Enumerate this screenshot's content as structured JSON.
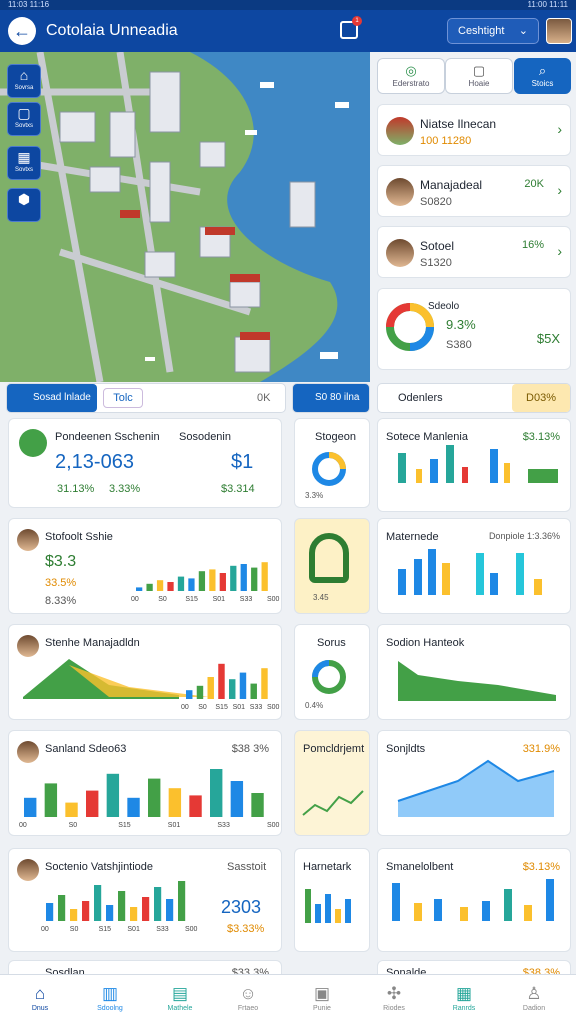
{
  "status": {
    "time": "11:03 11:16",
    "right": "11:00 11:11"
  },
  "header": {
    "title": "Cotolaia Unneadia",
    "location": "Ceshtight",
    "notif_count": "1"
  },
  "map_tools": [
    {
      "icon": "home-icon",
      "label": "Sovrsa"
    },
    {
      "icon": "square-icon",
      "label": "Sovtxs"
    },
    {
      "icon": "grid-icon",
      "label": "Sovtxs"
    },
    {
      "icon": "shield-icon",
      "label": ""
    }
  ],
  "filter_buttons": [
    {
      "label": "Ederstrato",
      "icon": "leaf-icon"
    },
    {
      "label": "Hoaie",
      "icon": "square-icon"
    },
    {
      "label": "Stoics",
      "icon": "search-icon"
    }
  ],
  "users": [
    {
      "name": "Niatse Ilnecan",
      "sub": "100 11280",
      "value": ""
    },
    {
      "name": "Manajadeal",
      "sub": "S0820",
      "value": "20K"
    },
    {
      "name": "Sotoel",
      "sub": "S1320",
      "value": "16%"
    }
  ],
  "summary": {
    "name": "Sdeolo",
    "pct": "9.3%",
    "sub": "S380",
    "value": "$5X"
  },
  "tab_left": {
    "active": "Sosad lnlade",
    "other": "Tolc",
    "aux": "0K"
  },
  "tab_mid": {
    "label": "S0 80 ilna"
  },
  "tab_right": {
    "title": "Odenlers",
    "badge": "D03%"
  },
  "cards_left": [
    {
      "title": "Pondeenen Sschenin",
      "value": "2,13-063",
      "metric": "$1",
      "sub": [
        "31.13%",
        "3.33%",
        "$3.314"
      ],
      "extra": "Sosodenin"
    },
    {
      "title": "Stofoolt Sshie",
      "value": "$3.3",
      "metric": "33.5%",
      "sub": [
        "8.33%"
      ]
    },
    {
      "title": "Stenhe Manajadldn",
      "value": "",
      "metric": "",
      "sub": []
    },
    {
      "title": "Sanland Sdeo63",
      "value": "$38 3%",
      "metric": "",
      "sub": []
    },
    {
      "title": "Soctenio Vatshjintiode",
      "value": "2303",
      "metric": "$3.33%",
      "sub": [],
      "extra": "Sasstoit"
    },
    {
      "title": "Sosdlan",
      "value": "$33 3%",
      "metric": "",
      "sub": []
    }
  ],
  "cards_mid": [
    {
      "title": "Stogeon",
      "value": "3.3%"
    },
    {
      "title": "",
      "value": "3.45"
    },
    {
      "title": "Sorus",
      "value": "0.4%"
    },
    {
      "title": "Pomcldrjemt",
      "value": ""
    },
    {
      "title": "Harnetark",
      "value": ""
    }
  ],
  "cards_right": [
    {
      "title": "Sotece Manlenia",
      "value": "$3.13%"
    },
    {
      "title": "Maternede",
      "value": "Donpiole 1:3.36%"
    },
    {
      "title": "Sodion Hanteok",
      "value": ""
    },
    {
      "title": "Sonjldts",
      "value": "331.9%"
    },
    {
      "title": "Smanelolbent",
      "value": "$3.13%"
    },
    {
      "title": "Sonalde",
      "value": "$38 3%"
    }
  ],
  "axis": [
    "00",
    "S0",
    "S15",
    "S01",
    "S33",
    "S00"
  ],
  "bottom_nav": [
    "Dnus",
    "Sdoolng",
    "Mathele",
    "Frtaeo",
    "Punie",
    "Riodes",
    "Ranrds",
    "Dadion"
  ],
  "chart_data": [
    {
      "type": "bar",
      "series": [
        {
          "name": "",
          "values": [
            40,
            70,
            30,
            55,
            90,
            40,
            80,
            60,
            45,
            100,
            75,
            50
          ]
        }
      ]
    },
    {
      "type": "area",
      "values": [
        10,
        20,
        30,
        25,
        40,
        35,
        55,
        60,
        50,
        70,
        75,
        65,
        80
      ]
    },
    {
      "type": "bar",
      "values": [
        20,
        30,
        50,
        80,
        45,
        60,
        35,
        70
      ]
    },
    {
      "type": "bar",
      "values": [
        45,
        65,
        30,
        50,
        90,
        40,
        75,
        35,
        60,
        85,
        55,
        100
      ]
    }
  ]
}
